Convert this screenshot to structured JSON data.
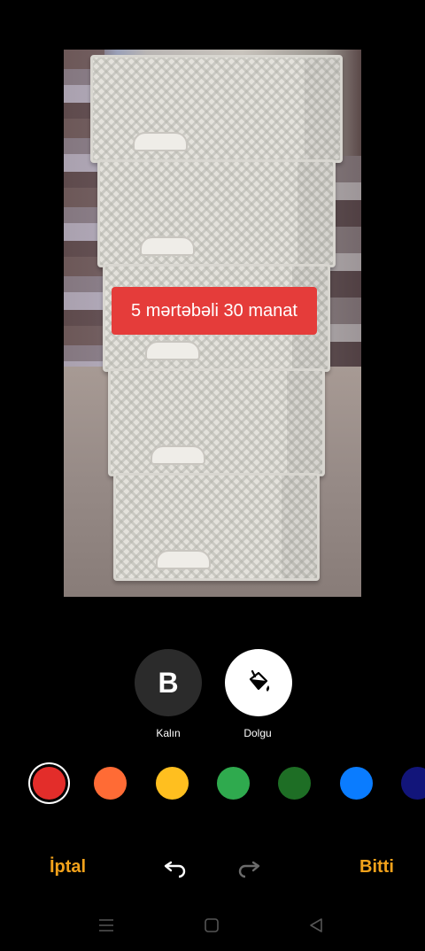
{
  "photo": {
    "caption": "5 mərtəbəli 30 manat"
  },
  "tools": {
    "bold": {
      "glyph": "B",
      "label": "Kalın"
    },
    "fill": {
      "label": "Dolgu",
      "icon": "paint-bucket-icon"
    }
  },
  "palette": {
    "selected_index": 0,
    "colors": [
      "#e32d2a",
      "#ff6b35",
      "#ffbf1f",
      "#2faa4e",
      "#1e6e25",
      "#0a7cff",
      "#12157a"
    ]
  },
  "bottom_bar": {
    "cancel_label": "İptal",
    "done_label": "Bitti",
    "undo_icon": "undo-icon",
    "redo_icon": "redo-icon"
  },
  "system_nav": {
    "menu_icon": "menu-icon",
    "home_icon": "home-square-icon",
    "back_icon": "back-triangle-icon"
  }
}
